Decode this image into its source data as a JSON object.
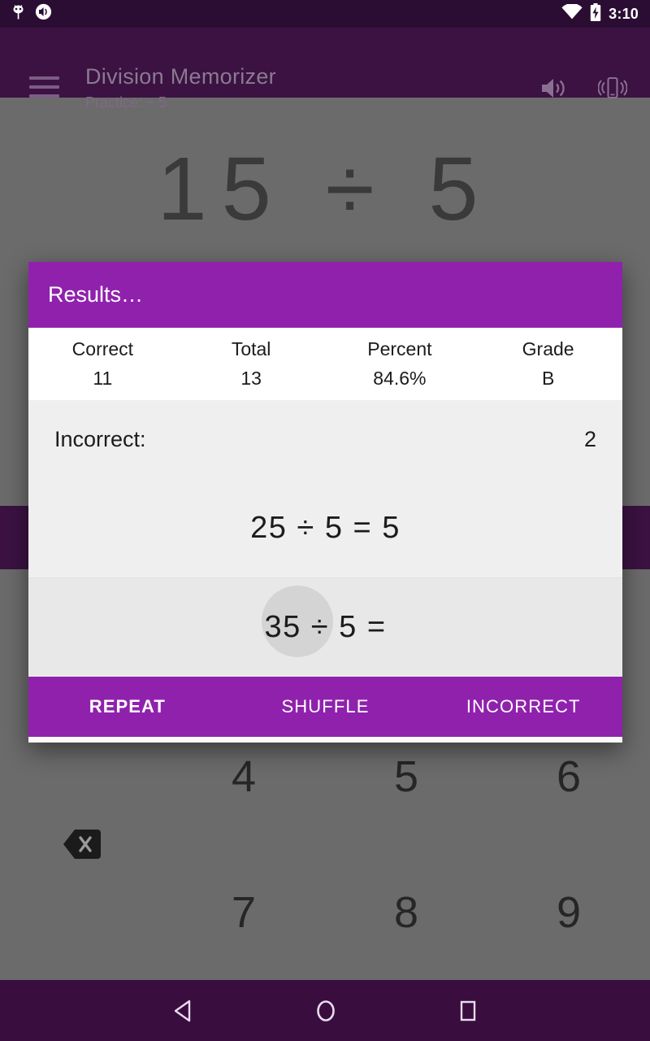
{
  "status_bar": {
    "icons": [
      "android-debug-icon",
      "volume-notification-icon",
      "wifi-icon",
      "battery-charging-icon"
    ],
    "clock": "3:10"
  },
  "app_bar": {
    "menu_icon": "hamburger-menu-icon",
    "title": "Division Memorizer",
    "subtitle": "Practice: ÷ 5",
    "actions": [
      "volume-up-icon",
      "vibration-icon"
    ]
  },
  "background": {
    "problem": "15 ÷ 5",
    "keypad": {
      "row1": [
        "",
        "4",
        "5",
        "6"
      ],
      "row2": [
        "",
        "",
        "",
        ""
      ],
      "row3": [
        "",
        "7",
        "8",
        "9"
      ],
      "backspace_icon": "backspace-icon"
    }
  },
  "dialog": {
    "title": "Results…",
    "stats": {
      "headers": [
        "Correct",
        "Total",
        "Percent",
        "Grade"
      ],
      "values": [
        "11",
        "13",
        "84.6%",
        "B"
      ]
    },
    "incorrect": {
      "label": "Incorrect:",
      "count": "2",
      "items": [
        "25 ÷ 5 = 5",
        "35 ÷ 5 ="
      ]
    },
    "actions": [
      "REPEAT",
      "SHUFFLE",
      "INCORRECT"
    ]
  },
  "nav_bar": {
    "back_icon": "back-triangle-icon",
    "home_icon": "home-circle-icon",
    "recents_icon": "recents-square-icon"
  },
  "colors": {
    "accent_purple": "#9021AD",
    "status_bar": "#2B0D33",
    "app_bar_dimmed": "#3B1242",
    "nav_bar": "#3A0D3F",
    "scrim": "#6B6B6B",
    "dialog_body": "#EFEFEF",
    "dialog_table": "#FFFFFF"
  }
}
